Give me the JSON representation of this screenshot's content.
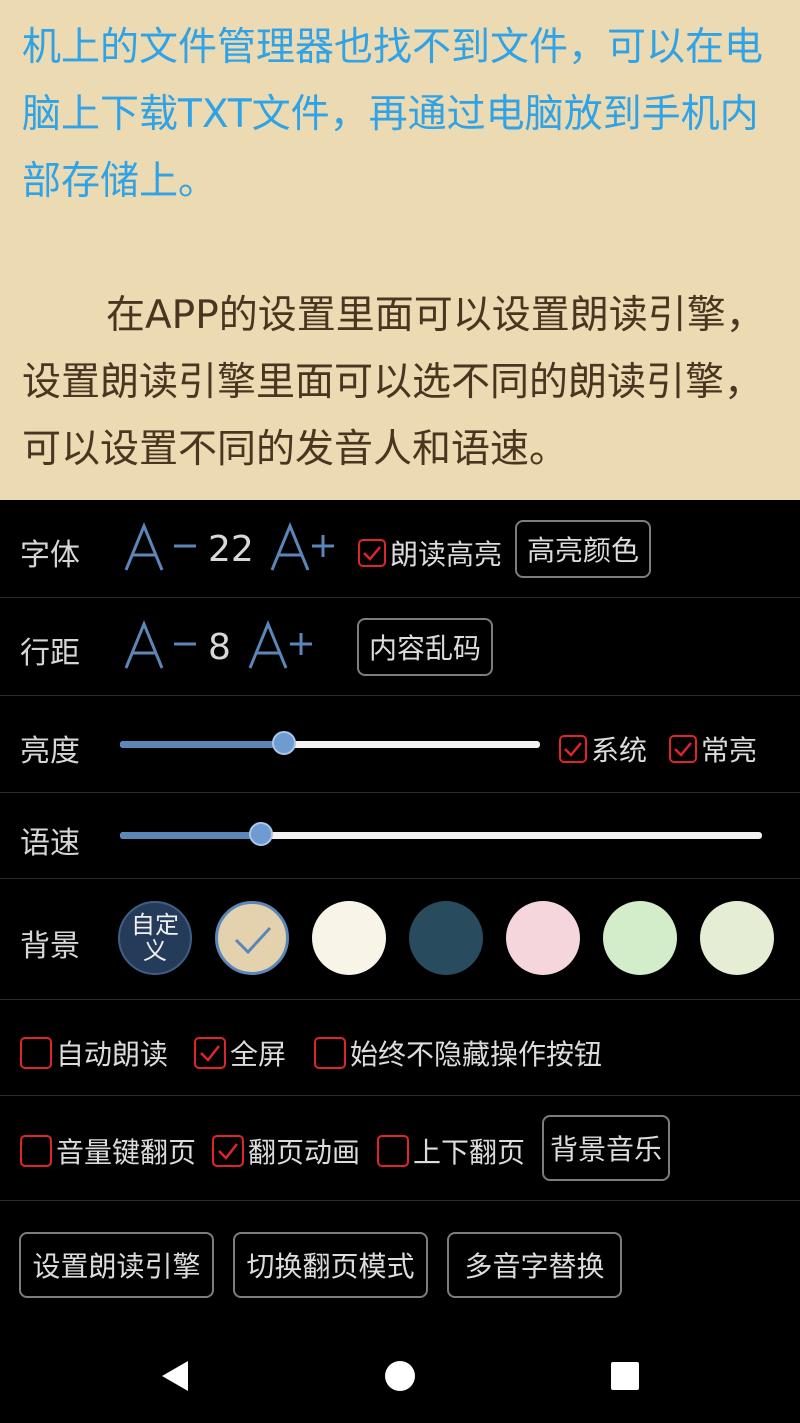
{
  "reader": {
    "paragraph_1": "机上的文件管理器也找不到文件，可以在电脑上下载TXT文件，再通过电脑放到手机内部存储上。",
    "paragraph_2": "在APP的设置里面可以设置朗读引擎，设置朗读引擎里面可以选不同的朗读引擎，可以设置不同的发音人和语速。"
  },
  "font_row": {
    "label": "字体",
    "size_value": "22",
    "checkbox_label": "朗读高亮",
    "checkbox_checked": true,
    "button_label": "高亮颜色"
  },
  "spacing_row": {
    "label": "行距",
    "value": "8",
    "button_label": "内容乱码"
  },
  "brightness_row": {
    "label": "亮度",
    "level": 0.39,
    "system_label": "系统",
    "system_checked": true,
    "keep_on_label": "常亮",
    "keep_on_checked": true
  },
  "speed_row": {
    "label": "语速",
    "level": 0.22
  },
  "background_row": {
    "label": "背景",
    "custom_label": "自定义",
    "swatches": [
      "#e4d2ae",
      "#f8f5e8",
      "#294b5e",
      "#f4d6dc",
      "#d3ecc9",
      "#e6edd5"
    ],
    "selected_index": 0
  },
  "options_row_1": [
    {
      "label": "自动朗读",
      "checked": false
    },
    {
      "label": "全屏",
      "checked": true
    },
    {
      "label": "始终不隐藏操作按钮",
      "checked": false
    }
  ],
  "options_row_2": {
    "items": [
      {
        "label": "音量键翻页",
        "checked": false
      },
      {
        "label": "翻页动画",
        "checked": true
      },
      {
        "label": "上下翻页",
        "checked": false
      }
    ],
    "button_label": "背景音乐"
  },
  "actions": [
    "设置朗读引擎",
    "切换翻页模式",
    "多音字替换"
  ],
  "colors": {
    "accent_checkbox": "#e0242c",
    "slider_fill": "#5b86b8",
    "font_icon": "#5b86b8"
  }
}
